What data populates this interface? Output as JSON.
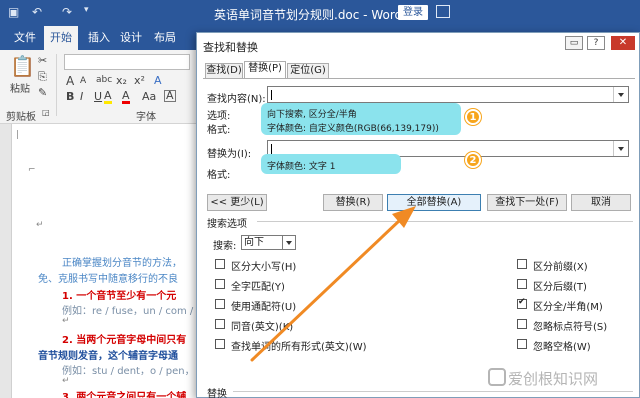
{
  "titlebar": {
    "title": "英语单词音节划分规则.doc - Word",
    "login_label": "登录"
  },
  "ribbon": {
    "tabs": [
      "文件",
      "开始",
      "插入",
      "设计",
      "布局"
    ],
    "active_tab": "开始",
    "paste_label": "粘贴",
    "clipboard_label": "剪贴板",
    "font_group_label": "字体",
    "font_glyphs": [
      "A",
      "A",
      "B",
      "I",
      "U",
      "abc",
      "x₂",
      "x²",
      "A",
      "A",
      "Aa",
      "A",
      "A"
    ]
  },
  "document": {
    "lines": [
      "正确掌握划分音节的方法，",
      "免、克服书写中随意移行的不良",
      "1.  一个音节至少有一个元",
      "例如：re / fuse，un / com /",
      "2.  当两个元音字母中间只有",
      "音节规则发音，这个辅音字母通",
      "例如：stu / dent，o / pen，",
      "3.  两个元音之间只有一个辅"
    ]
  },
  "dialog": {
    "title": "查找和替换",
    "tabs": [
      "查找(D)",
      "替换(P)",
      "定位(G)"
    ],
    "active_tab": "替换(P)",
    "find_label": "查找内容(N):",
    "find_value": "",
    "options_label": "选项:",
    "format_label": "格式:",
    "replace_label": "替换为(I):",
    "replace_value": "",
    "replace_format_label": "格式:",
    "find_annotation": {
      "line1": "向下搜索, 区分全/半角",
      "line2": "字体颜色: 自定义颜色(RGB(66,139,179))",
      "badge": "1"
    },
    "replace_annotation": {
      "line1": "字体颜色: 文字 1",
      "badge": "2"
    },
    "buttons": {
      "less": "<< 更少(L)",
      "replace": "替换(R)",
      "replace_all": "全部替换(A)",
      "find_next": "查找下一处(F)",
      "cancel": "取消"
    },
    "search_options_title": "搜索选项",
    "search_label": "搜索:",
    "search_direction": "向下",
    "left_options": [
      {
        "label": "区分大小写(H)",
        "checked": false
      },
      {
        "label": "全字匹配(Y)",
        "checked": false
      },
      {
        "label": "使用通配符(U)",
        "checked": false
      },
      {
        "label": "同音(英文)(K)",
        "checked": false
      },
      {
        "label": "查找单词的所有形式(英文)(W)",
        "checked": false
      }
    ],
    "right_options": [
      {
        "label": "区分前缀(X)",
        "checked": false
      },
      {
        "label": "区分后缀(T)",
        "checked": false
      },
      {
        "label": "区分全/半角(M)",
        "checked": true
      },
      {
        "label": "忽略标点符号(S)",
        "checked": false
      },
      {
        "label": "忽略空格(W)",
        "checked": false
      }
    ],
    "replace_section_title": "替换"
  },
  "watermark": "爱创根知识网",
  "colors": {
    "word_blue": "#2b579a",
    "annotation_bg": "#8be3ed",
    "badge_orange": "#f7a51c",
    "arrow_orange": "#f08a24",
    "doc_red": "#d40000",
    "doc_blue": "#4a86c5"
  }
}
